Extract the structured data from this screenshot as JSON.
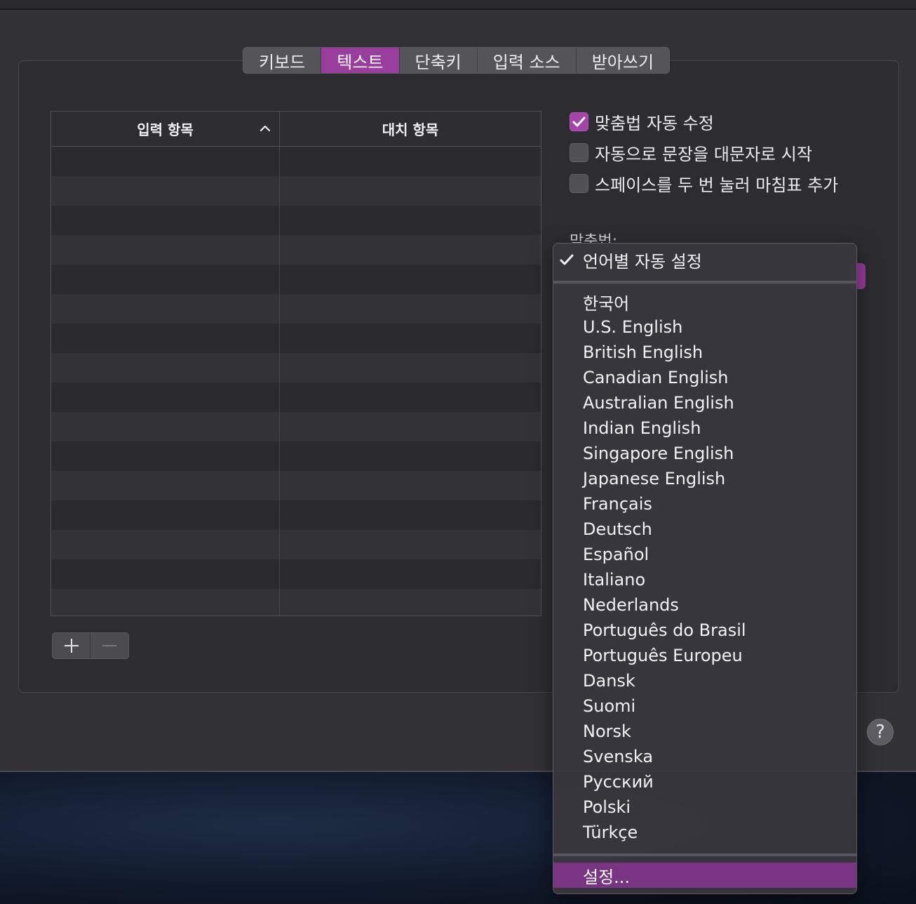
{
  "tabs": [
    {
      "label": "키보드"
    },
    {
      "label": "텍스트",
      "active": true
    },
    {
      "label": "단축키"
    },
    {
      "label": "입력 소스"
    },
    {
      "label": "받아쓰기"
    }
  ],
  "table": {
    "col_input": "입력 항목",
    "col_replace": "대치 항목",
    "sort": "ascending"
  },
  "options": {
    "autocorrect": {
      "label": "맞춤법 자동 수정",
      "checked": true
    },
    "capitalize": {
      "label": "자동으로 문장을 대문자로 시작",
      "checked": false
    },
    "double_space": {
      "label": "스페이스를 두 번 눌러 마침표 추가",
      "checked": false
    }
  },
  "spelling_label": "맞춤법:",
  "menu": {
    "selected": "언어별 자동 설정",
    "languages": [
      "한국어",
      "U.S. English",
      "British English",
      "Canadian English",
      "Australian English",
      "Indian English",
      "Singapore English",
      "Japanese English",
      "Français",
      "Deutsch",
      "Español",
      "Italiano",
      "Nederlands",
      "Português do Brasil",
      "Português Europeu",
      "Dansk",
      "Suomi",
      "Norsk",
      "Svenska",
      "Русский",
      "Polski",
      "Türkçe"
    ],
    "setup": "설정..."
  },
  "help": "?",
  "colors": {
    "accent": "#9a3e9e",
    "menu_highlight": "#7a3484"
  }
}
